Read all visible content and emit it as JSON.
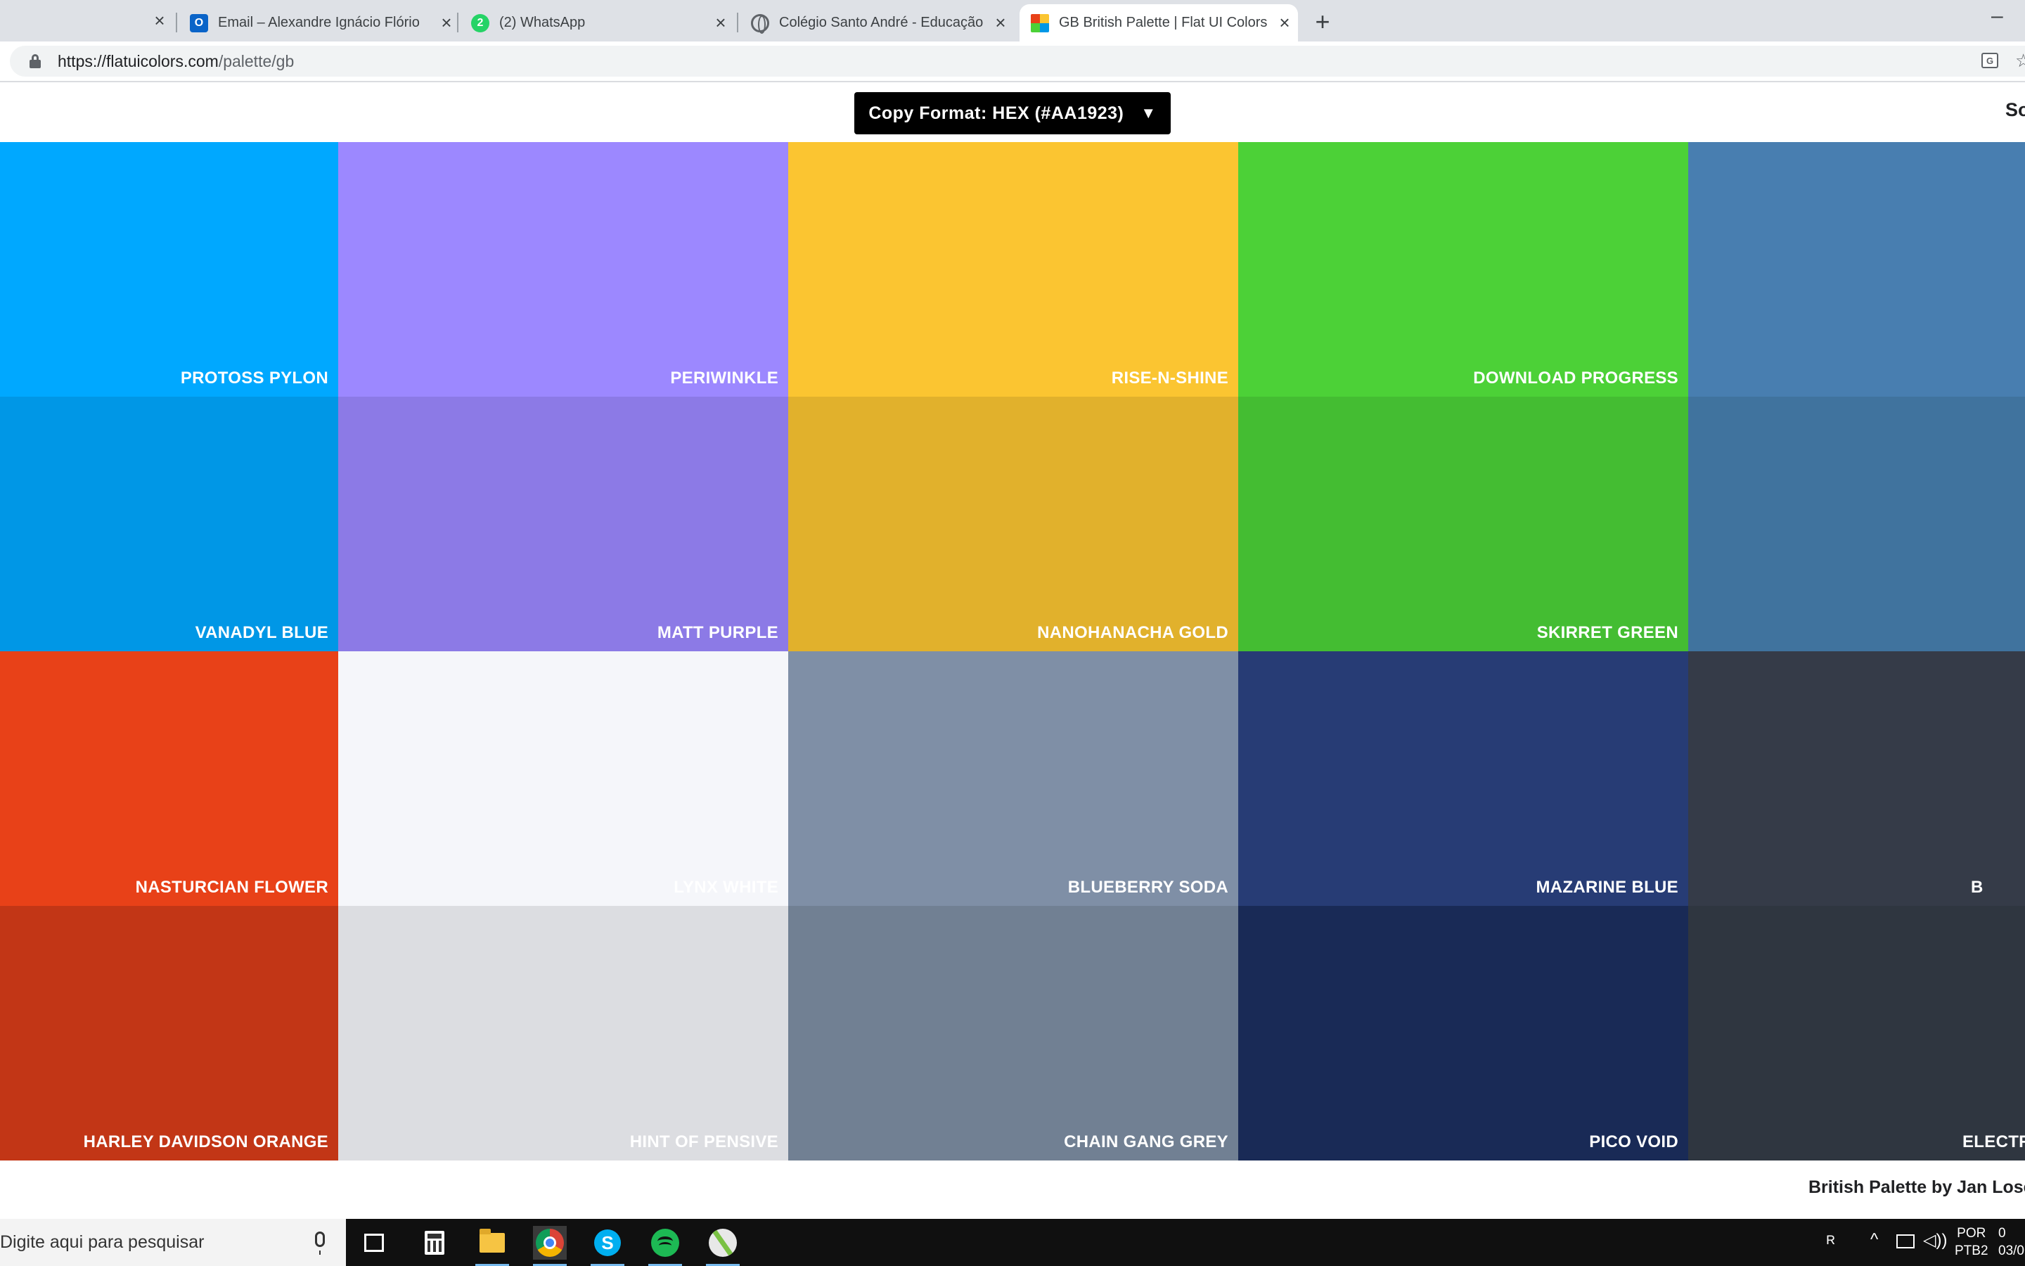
{
  "browser": {
    "tabs": [
      {
        "title": "Email – Alexandre Ignácio Flório",
        "favicon": "outlook-icon",
        "favicon_text": "O",
        "active": false
      },
      {
        "title": "(2) WhatsApp",
        "favicon": "whatsapp-icon",
        "favicon_text": "2",
        "active": false
      },
      {
        "title": "Colégio Santo André - Educação",
        "favicon": "globe-icon",
        "active": false
      },
      {
        "title": "GB British Palette | Flat UI Colors",
        "favicon": "flatuicolors-icon",
        "active": true
      }
    ],
    "tab_close_glyph": "×",
    "new_tab_glyph": "+",
    "minimize_glyph": "–",
    "address": {
      "host": "https://flatuicolors.com",
      "path": "/palette/gb"
    },
    "translate_icon_text": "G",
    "bookmark_glyph": "☆"
  },
  "page": {
    "copy_format_label": "Copy Format: HEX (#AA1923)",
    "copy_format_arrow": "▼",
    "sound_label": "So",
    "credit": "British Palette by Jan Lose",
    "swatches": [
      {
        "name": "Protoss Pylon",
        "color": "#00a8ff",
        "text_color": "#ffffff"
      },
      {
        "name": "Periwinkle",
        "color": "#9c88ff",
        "text_color": "#ffffff"
      },
      {
        "name": "Rise-N-Shine",
        "color": "#fbc531",
        "text_color": "#ffffff"
      },
      {
        "name": "Download Progress",
        "color": "#4cd137",
        "text_color": "#ffffff"
      },
      {
        "name": "",
        "color": "#487eb0",
        "text_color": "#ffffff"
      },
      {
        "name": "Vanadyl Blue",
        "color": "#0097e6",
        "text_color": "#ffffff"
      },
      {
        "name": "Matt Purple",
        "color": "#8c7ae6",
        "text_color": "#ffffff"
      },
      {
        "name": "Nanohanacha Gold",
        "color": "#e1b12c",
        "text_color": "#ffffff"
      },
      {
        "name": "Skirret Green",
        "color": "#44bd32",
        "text_color": "#ffffff"
      },
      {
        "name": "",
        "color": "#40739e",
        "text_color": "#ffffff"
      },
      {
        "name": "Nasturcian Flower",
        "color": "#e84118",
        "text_color": "#ffffff"
      },
      {
        "name": "Lynx White",
        "color": "#f5f6fa",
        "text_color": "#ffffff"
      },
      {
        "name": "Blueberry Soda",
        "color": "#7f8fa6",
        "text_color": "#ffffff"
      },
      {
        "name": "Mazarine Blue",
        "color": "#273c75",
        "text_color": "#ffffff"
      },
      {
        "name": "B",
        "color": "#353b48",
        "text_color": "#ffffff"
      },
      {
        "name": "Harley Davidson Orange",
        "color": "#c23616",
        "text_color": "#ffffff"
      },
      {
        "name": "Hint of Pensive",
        "color": "#dcdde1",
        "text_color": "#ffffff"
      },
      {
        "name": "Chain Gang Grey",
        "color": "#718093",
        "text_color": "#ffffff"
      },
      {
        "name": "Pico Void",
        "color": "#192a56",
        "text_color": "#ffffff"
      },
      {
        "name": "Electr",
        "color": "#2f3640",
        "text_color": "#ffffff"
      }
    ]
  },
  "taskbar": {
    "search_placeholder": "Digite aqui para pesquisar",
    "apps": [
      "task-view-icon",
      "calculator-icon",
      "file-explorer-icon",
      "chrome-icon",
      "skype-icon",
      "spotify-icon",
      "app-icon"
    ],
    "skype_letter": "S",
    "tray": {
      "person_glyph": "ᴿ",
      "up_glyph": "^",
      "volume_glyph": "◁))",
      "lang_line1": "POR",
      "lang_line2": "PTB2",
      "clock_line1": "0",
      "clock_line2": "03/0"
    }
  }
}
